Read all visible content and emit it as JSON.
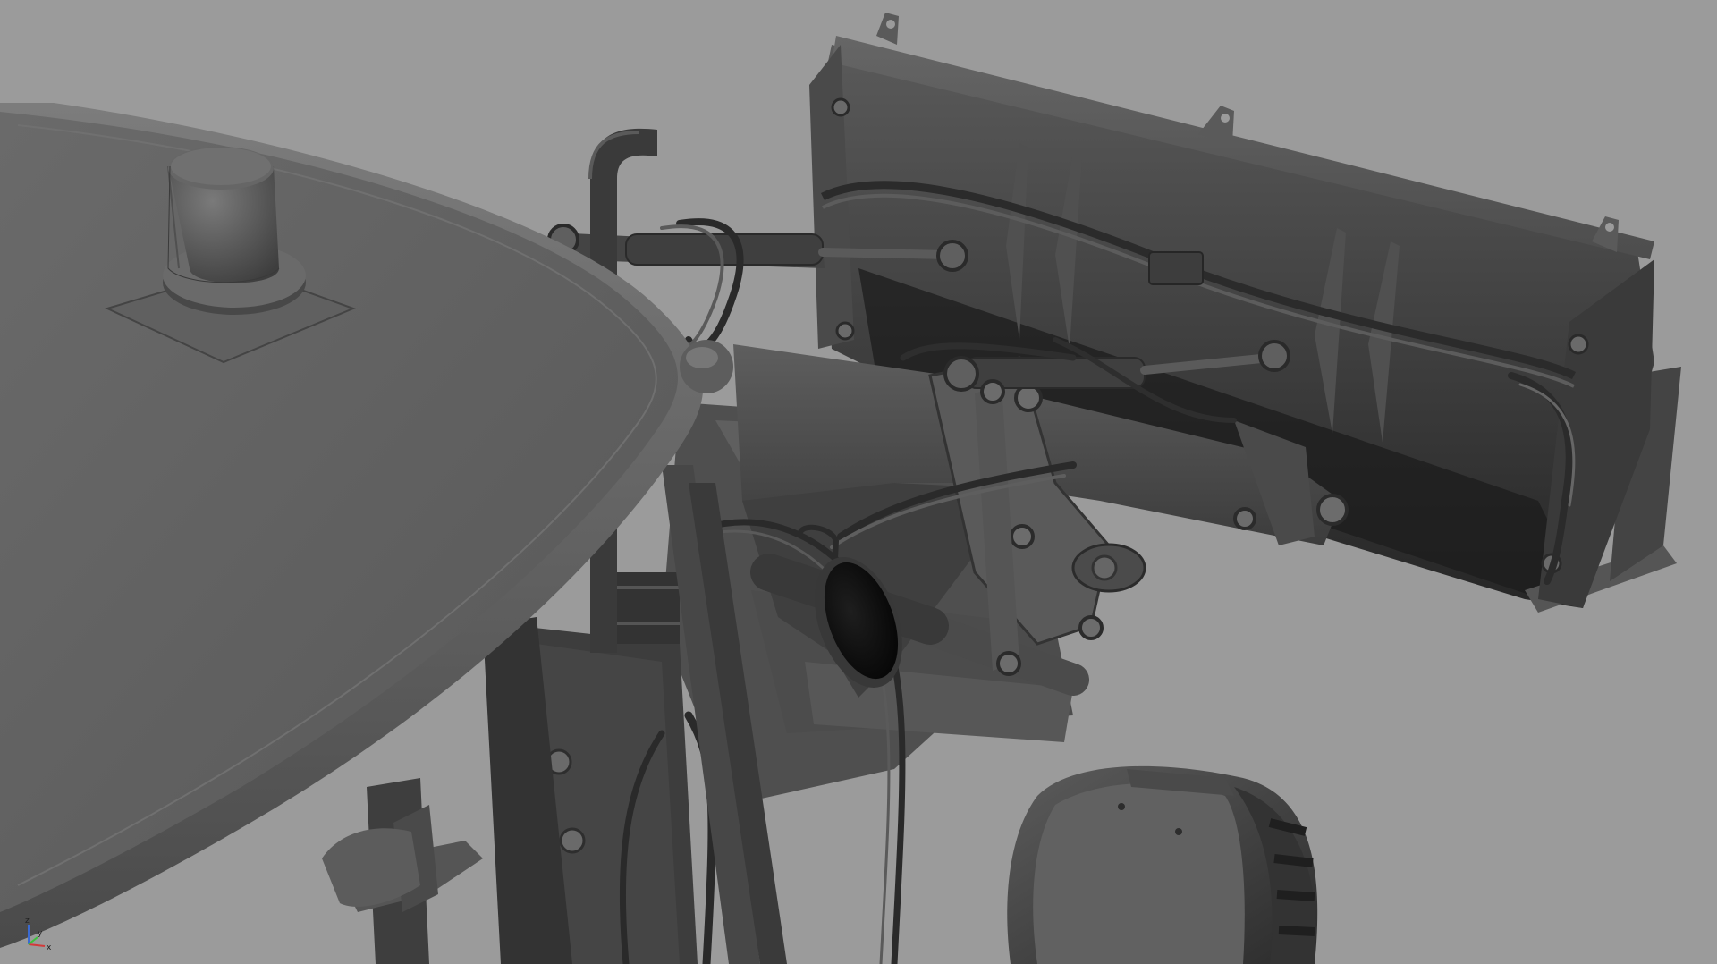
{
  "viewport": {
    "background": "#9b9b9b",
    "shading": "smooth-gray"
  },
  "model": {
    "material_base": "#5a5a5a",
    "material_dark": "#2b2b2b",
    "material_light": "#7a7a7a"
  },
  "gizmo": {
    "icon": "axis-triad-icon",
    "axes": {
      "x": "x",
      "y": "y",
      "z": "z"
    },
    "colors": {
      "x": "#d23a3a",
      "y": "#3ac23a",
      "z": "#3a6ad2"
    }
  }
}
